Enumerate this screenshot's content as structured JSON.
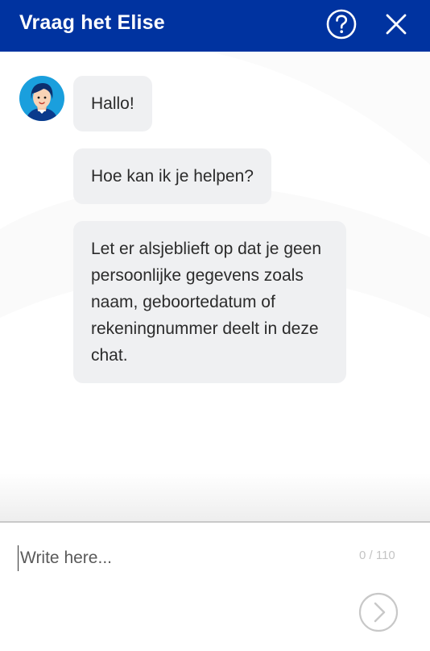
{
  "header": {
    "title": "Vraag het Elise",
    "help_icon": "question-circle-icon",
    "close_icon": "close-icon",
    "background_color": "#0033a0"
  },
  "chat": {
    "agent_avatar": "agent-avatar-elise",
    "messages": [
      {
        "sender": "agent",
        "text": "Hallo!"
      },
      {
        "sender": "agent",
        "text": "Hoe kan ik je helpen?"
      },
      {
        "sender": "agent",
        "text": "Let er alsjeblieft op dat je geen persoonlijke gegevens zoals naam, geboortedatum of rekeningnummer deelt in deze chat."
      }
    ],
    "bubble_color": "#eff0f2"
  },
  "composer": {
    "placeholder": "Write here...",
    "value": "",
    "counter": "0 / 110",
    "send_icon": "chevron-right-circle-icon"
  }
}
